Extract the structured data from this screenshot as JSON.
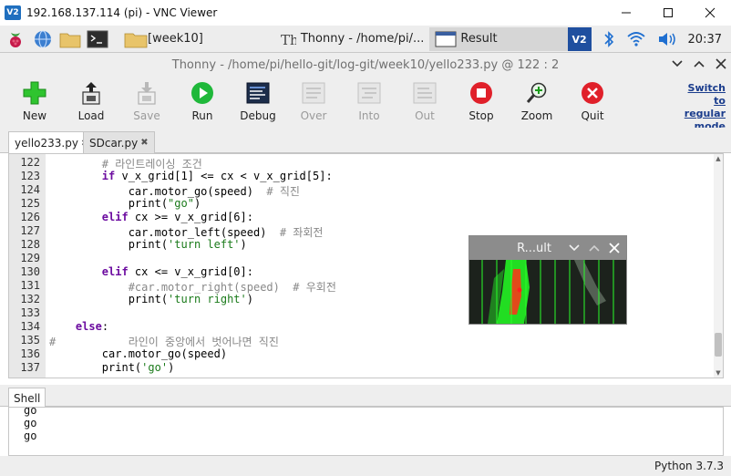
{
  "vnc": {
    "logo": "V2",
    "title": "192.168.137.114 (pi) - VNC Viewer",
    "controls": [
      "minimize-icon",
      "maximize-icon",
      "close-icon"
    ]
  },
  "taskbar": {
    "tasks": [
      {
        "label": "[week10]",
        "icon": "folder-icon"
      },
      {
        "label": "Thonny  -  /home/pi/...",
        "icon": "thonny-icon"
      },
      {
        "label": "Result",
        "icon": "window-icon"
      }
    ],
    "clock": "20:37"
  },
  "thonny": {
    "title": "Thonny  -  /home/pi/hello-git/log-git/week10/yello233.py  @  122 : 2",
    "toolbar": [
      {
        "label": "New",
        "icon": "new-icon",
        "enabled": true
      },
      {
        "label": "Load",
        "icon": "load-icon",
        "enabled": true
      },
      {
        "label": "Save",
        "icon": "save-icon",
        "enabled": false
      },
      {
        "label": "Run",
        "icon": "run-icon",
        "enabled": true
      },
      {
        "label": "Debug",
        "icon": "debug-icon",
        "enabled": true
      },
      {
        "label": "Over",
        "icon": "step-over-icon",
        "enabled": false
      },
      {
        "label": "Into",
        "icon": "step-into-icon",
        "enabled": false
      },
      {
        "label": "Out",
        "icon": "step-out-icon",
        "enabled": false
      },
      {
        "label": "Stop",
        "icon": "stop-icon",
        "enabled": true
      },
      {
        "label": "Zoom",
        "icon": "zoom-icon",
        "enabled": true
      },
      {
        "label": "Quit",
        "icon": "quit-icon",
        "enabled": true
      }
    ],
    "switch_mode": "Switch to regular mode",
    "tabs": [
      {
        "label": "yello233.py",
        "active": true
      },
      {
        "label": "SDcar.py",
        "active": false
      }
    ],
    "tab_close": "✖"
  },
  "editor": {
    "line_numbers": [
      "122",
      "123",
      "124",
      "125",
      "126",
      "127",
      "128",
      "129",
      "130",
      "131",
      "132",
      "133",
      "134",
      "135",
      "136",
      "137"
    ],
    "lines": [
      "        # 라인트레이싱 조건",
      "        if v_x_grid[1] <= cx < v_x_grid[5]:",
      "            car.motor_go(speed)  # 직진",
      "            print(\"go\")",
      "        elif cx >= v_x_grid[6]:",
      "            car.motor_left(speed)  # 좌회전",
      "            print('turn left')",
      "",
      "        elif cx <= v_x_grid[0]:",
      "            #car.motor_right(speed)  # 우회전",
      "            print('turn right')",
      "",
      "    else:",
      "#           라인이 중앙에서 벗어나면 직진",
      "        car.motor_go(speed)",
      "        print('go')"
    ]
  },
  "result_window": {
    "title": "R...ult",
    "controls": [
      "chevron-down-icon",
      "chevron-up-icon",
      "close-icon"
    ]
  },
  "shell": {
    "tab_label": "Shell",
    "lines": [
      "go",
      "go",
      "go"
    ]
  },
  "status": {
    "text": "Python 3.7.3"
  },
  "colors": {
    "keyword": "#6c0ca0",
    "comment": "#888888",
    "string": "#1a7a1a",
    "line_green": "#27ff27",
    "center_red": "#ff3030"
  }
}
